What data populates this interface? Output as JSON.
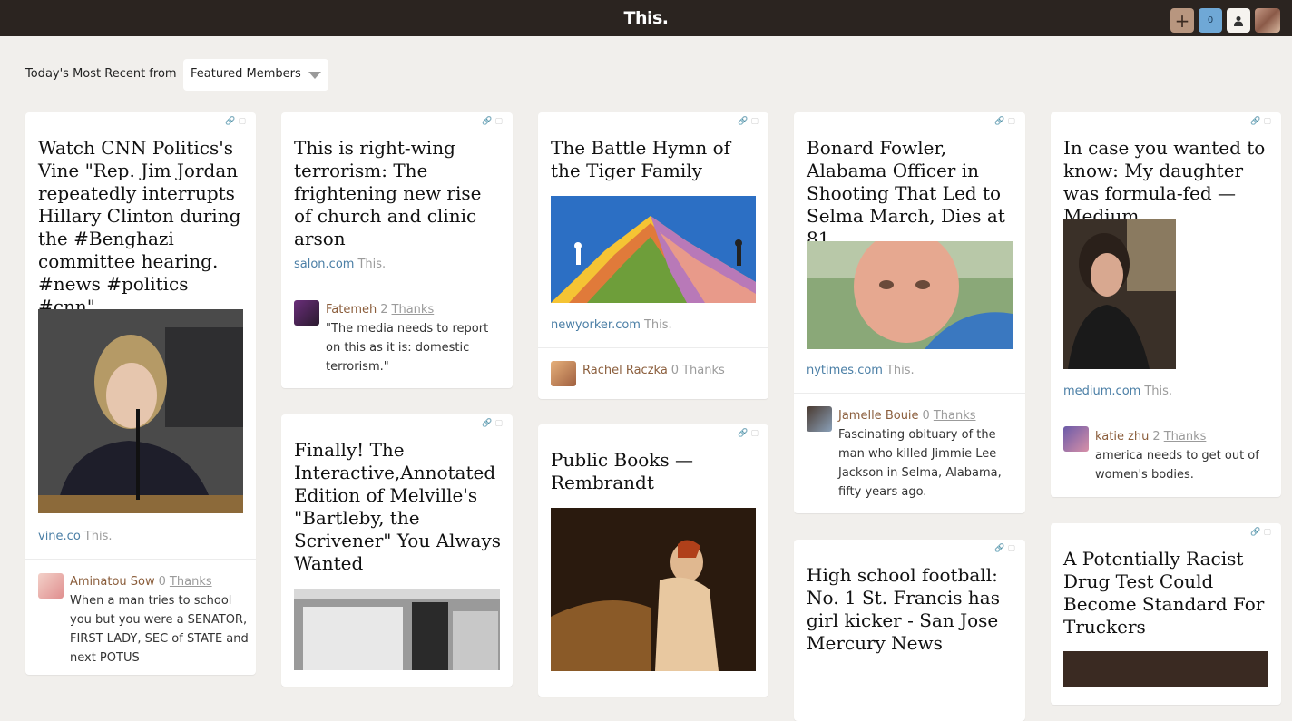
{
  "header": {
    "logo": "This.",
    "add_icon_glyph": "+",
    "notification_count": "0",
    "add_icon": "plus-icon",
    "profile_icon": "profile-icon"
  },
  "filter": {
    "label": "Today's Most Recent from",
    "selected": "Featured Members"
  },
  "cards": [
    {
      "title": "Watch CNN Politics's Vine \"Rep. Jim Jordan repeatedly interrupts Hillary Clinton during the #Benghazi committee hearing. #news #politics #cnn\"",
      "domain": "vine.co",
      "this": "This.",
      "user": "Aminatou Sow",
      "thanks_count": "0",
      "thanks_label": "Thanks",
      "comment": "When a man tries to school you but you were a SENATOR, FIRST LADY, SEC of STATE and next POTUS"
    },
    {
      "title": "This is right-wing terrorism: The frightening new rise of church and clinic arson",
      "domain": "salon.com",
      "this": "This.",
      "user": "Fatemeh",
      "thanks_count": "2",
      "thanks_label": "Thanks",
      "comment": "\"The media needs to report on this as it is: domestic terrorism.\""
    },
    {
      "title": "Finally! The Interactive,Annotated Edition of Melville's \"Bartleby, the Scrivener\" You Always Wanted"
    },
    {
      "title": "The Battle Hymn of the Tiger Family",
      "domain": "newyorker.com",
      "this": "This.",
      "user": "Rachel Raczka",
      "thanks_count": "0",
      "thanks_label": "Thanks"
    },
    {
      "title": "Public Books — Rembrandt"
    },
    {
      "title": "Bonard Fowler, Alabama Officer in Shooting That Led to Selma March, Dies at 81",
      "domain": "nytimes.com",
      "this": "This.",
      "user": "Jamelle Bouie",
      "thanks_count": "0",
      "thanks_label": "Thanks",
      "comment": "Fascinating obituary of the man who killed Jimmie Lee Jackson in Selma, Alabama, fifty years ago."
    },
    {
      "title": "High school football: No. 1 St. Francis has girl kicker - San Jose Mercury News"
    },
    {
      "title": "In case you wanted to know: My daughter was formula-fed — Medium",
      "domain": "medium.com",
      "this": "This.",
      "user": "katie zhu",
      "thanks_count": "2",
      "thanks_label": "Thanks",
      "comment": "america needs to get out of women's bodies."
    },
    {
      "title": "A Potentially Racist Drug Test Could Become Standard For Truckers"
    }
  ]
}
